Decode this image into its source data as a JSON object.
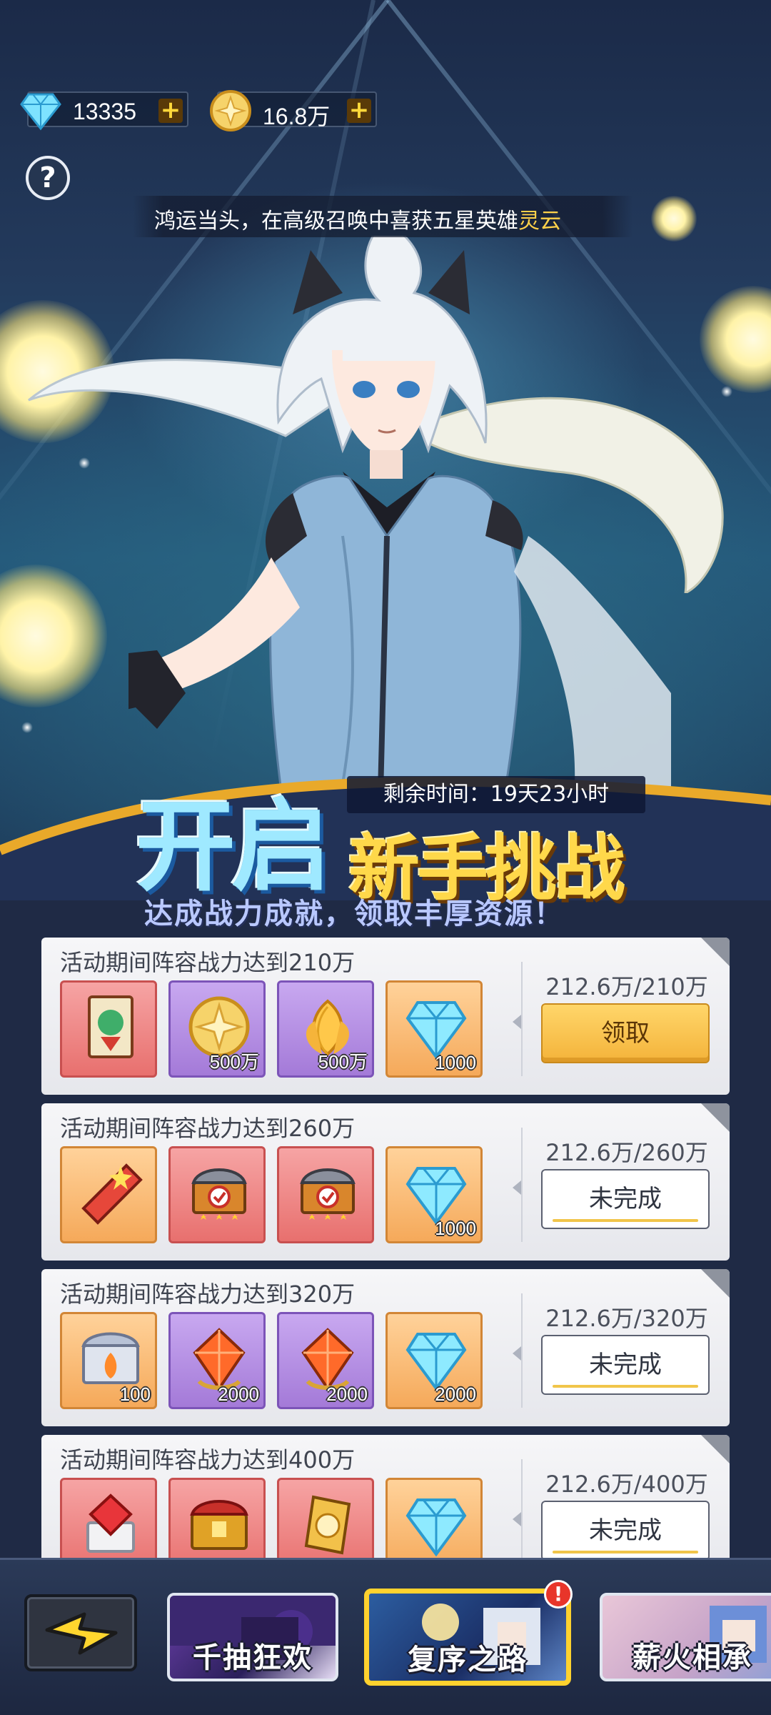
{
  "currency": {
    "diamonds": "13335",
    "gold": "16.8万",
    "plus": "+"
  },
  "help": {
    "label": "?"
  },
  "marquee": {
    "text": "鸿运当头，在高级召唤中喜获五星英雄",
    "hero": "灵云"
  },
  "banner": {
    "timer": "剩余时间：19天23小时",
    "title_open": "开启",
    "title_challenge": "新手挑战",
    "subtitle": "达成战力成就，领取丰厚资源！"
  },
  "tasks": [
    {
      "desc": "活动期间阵容战力达到210万",
      "progress": "212.6万/210万",
      "button": "领取",
      "items": [
        {
          "icon": "hero-card-icon",
          "bg": "red",
          "qty": ""
        },
        {
          "icon": "gold-coin-icon",
          "bg": "purple",
          "qty": "500万"
        },
        {
          "icon": "golden-petal-icon",
          "bg": "purple",
          "qty": "500万"
        },
        {
          "icon": "diamond-icon",
          "bg": "orange",
          "qty": "1000"
        }
      ]
    },
    {
      "desc": "活动期间阵容战力达到260万",
      "progress": "212.6万/260万",
      "button": "未完成",
      "items": [
        {
          "icon": "star-ticket-icon",
          "bg": "orange",
          "qty": ""
        },
        {
          "icon": "three-star-chest-icon",
          "bg": "red",
          "qty": ""
        },
        {
          "icon": "three-star-chest-icon",
          "bg": "red",
          "qty": ""
        },
        {
          "icon": "diamond-icon",
          "bg": "orange",
          "qty": "1000"
        }
      ]
    },
    {
      "desc": "活动期间阵容战力达到320万",
      "progress": "212.6万/320万",
      "button": "未完成",
      "items": [
        {
          "icon": "fire-chest-icon",
          "bg": "orange",
          "qty": "100"
        },
        {
          "icon": "red-gem-icon",
          "bg": "purple",
          "qty": "2000"
        },
        {
          "icon": "red-gem-icon",
          "bg": "purple",
          "qty": "2000"
        },
        {
          "icon": "diamond-icon",
          "bg": "orange",
          "qty": "2000"
        }
      ]
    },
    {
      "desc": "活动期间阵容战力达到400万",
      "progress": "212.6万/400万",
      "button": "未完成",
      "items": [
        {
          "icon": "ruby-chest-icon",
          "bg": "red",
          "qty": ""
        },
        {
          "icon": "golden-chest-icon",
          "bg": "red",
          "qty": ""
        },
        {
          "icon": "general-token-icon",
          "bg": "red",
          "qty": ""
        },
        {
          "icon": "diamond-icon",
          "bg": "orange",
          "qty": ""
        }
      ]
    }
  ],
  "nav": {
    "tabs": [
      {
        "label": "千抽狂欢"
      },
      {
        "label": "复序之路",
        "badge": "!"
      },
      {
        "label": "薪火相承"
      }
    ]
  }
}
